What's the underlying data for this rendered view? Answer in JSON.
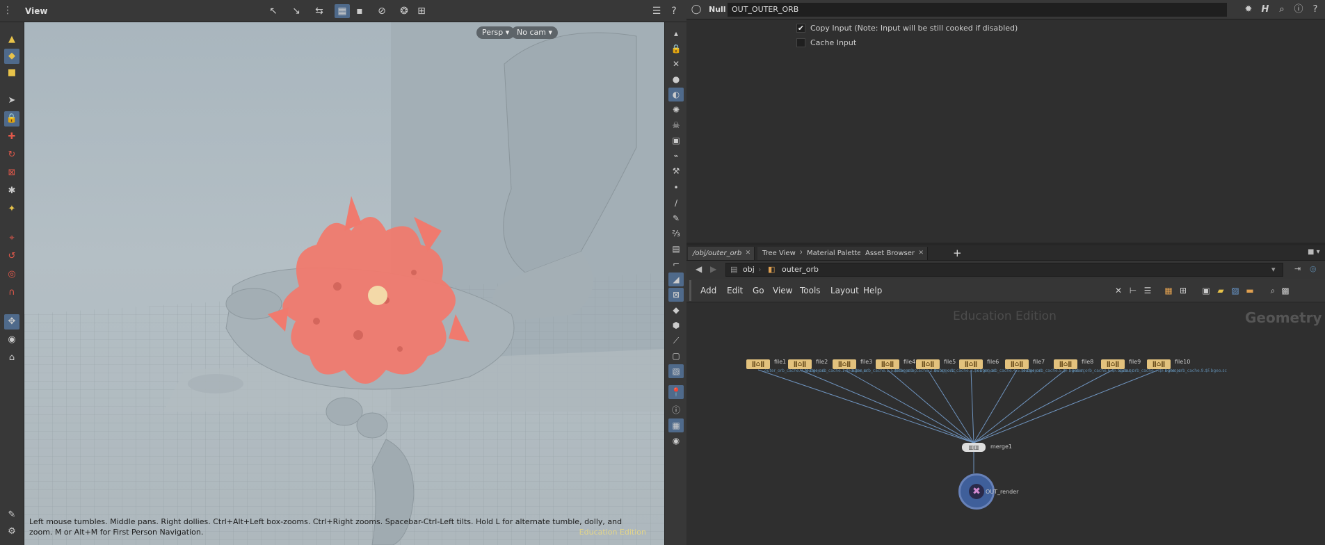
{
  "viewer": {
    "title": "View",
    "persp_label": "Persp ▾",
    "cam_label": "No cam ▾",
    "help_text": "Left mouse tumbles. Middle pans. Right dollies. Ctrl+Alt+Left box-zooms. Ctrl+Right zooms. Spacebar-Ctrl-Left tilts. Hold L for alternate tumble, dolly, and zoom.     M or Alt+M for First Person Navigation.",
    "edition": "Education Edition"
  },
  "params": {
    "node_type": "Null",
    "node_name": "OUT_OUTER_ORB",
    "copy_input_label": "Copy Input (Note: Input will be still cooked if disabled)",
    "copy_input_checked": "✔",
    "cache_input_label": "Cache Input"
  },
  "tabs": [
    {
      "label": "/obj/outer_orb"
    },
    {
      "label": "Tree View"
    },
    {
      "label": "Material Palette"
    },
    {
      "label": "Asset Browser"
    }
  ],
  "tab_add": "+",
  "path": {
    "root": "obj",
    "node": "outer_orb"
  },
  "menu": [
    "Add",
    "Edit",
    "Go",
    "View",
    "Tools",
    "Layout",
    "Help"
  ],
  "network": {
    "edition": "Education Edition",
    "context": "Geometry",
    "file_nodes": [
      {
        "name": "file1",
        "sub": "outer_orb_cache.0.$F.bgeo.sc"
      },
      {
        "name": "file2",
        "sub": "outer_orb_cache.1.$F.bgeo.sc"
      },
      {
        "name": "file3",
        "sub": "outer_orb_cache.1.5.$F.bgeo.sc"
      },
      {
        "name": "file4",
        "sub": "outer_orb_cache.2.$F.bgeo.sc"
      },
      {
        "name": "file5",
        "sub": "outer_orb_cache.3.$F.bgeo.sc"
      },
      {
        "name": "file6",
        "sub": "outer_orb_cache.4.5.$F.bgeo.sc"
      },
      {
        "name": "file7",
        "sub": "outer_orb_cache.5.$F.bgeo.sc"
      },
      {
        "name": "file8",
        "sub": "outer_orb_cache.6.$F.bgeo.sc"
      },
      {
        "name": "file9",
        "sub": "outer_orb_cache.7.$F.bgeo.sc"
      },
      {
        "name": "file10",
        "sub": "outer_orb_cache.9.$F.bgeo.sc"
      }
    ],
    "merge_name": "merge1",
    "render_name": "OUT_render"
  },
  "colors": {
    "accent": "#4f6a8b",
    "file_node": "#e3c27d",
    "particles": "#f07a6e",
    "render_node": "#3f5f9a"
  }
}
